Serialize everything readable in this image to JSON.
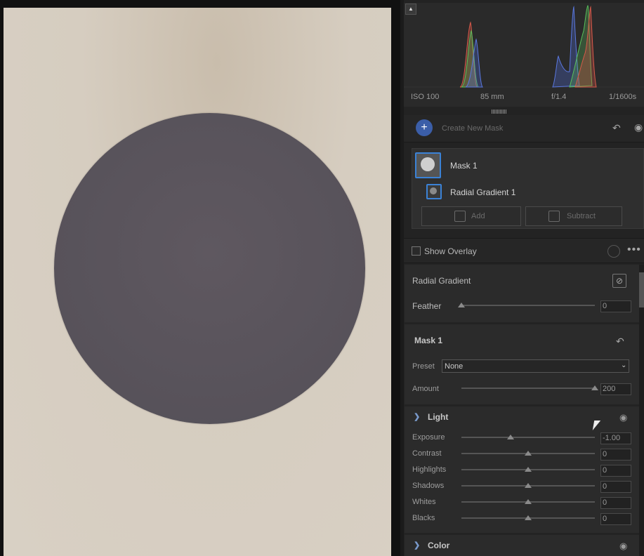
{
  "histogram": {
    "iso": "ISO 100",
    "focal_length": "85 mm",
    "aperture": "f/1.4",
    "shutter": "1/1600s"
  },
  "masking": {
    "create_label": "Create New Mask",
    "mask_name": "Mask 1",
    "component_name": "Radial Gradient 1",
    "add_label": "Add",
    "subtract_label": "Subtract"
  },
  "overlay": {
    "label": "Show Overlay",
    "checked": false
  },
  "radial": {
    "title": "Radial Gradient",
    "feather_label": "Feather",
    "feather_value": "0",
    "feather_pos": 0.0
  },
  "mask1": {
    "title": "Mask 1",
    "preset_label": "Preset",
    "preset_value": "None",
    "amount_label": "Amount",
    "amount_value": "200",
    "amount_pos": 1.0
  },
  "light": {
    "title": "Light",
    "sliders": [
      {
        "label": "Exposure",
        "value": "-1.00",
        "pos": 0.37
      },
      {
        "label": "Contrast",
        "value": "0",
        "pos": 0.5
      },
      {
        "label": "Highlights",
        "value": "0",
        "pos": 0.5
      },
      {
        "label": "Shadows",
        "value": "0",
        "pos": 0.5
      },
      {
        "label": "Whites",
        "value": "0",
        "pos": 0.5
      },
      {
        "label": "Blacks",
        "value": "0",
        "pos": 0.5
      }
    ]
  },
  "color": {
    "title": "Color"
  },
  "colors": {
    "accent": "#3b82d6",
    "mask_fill": "#57525a",
    "photo_bg": "#d6cdc0"
  },
  "icons": [
    "plus-icon",
    "undo-icon",
    "eye-icon",
    "more-icon",
    "radial-gradient-icon",
    "chevron-down-icon"
  ]
}
